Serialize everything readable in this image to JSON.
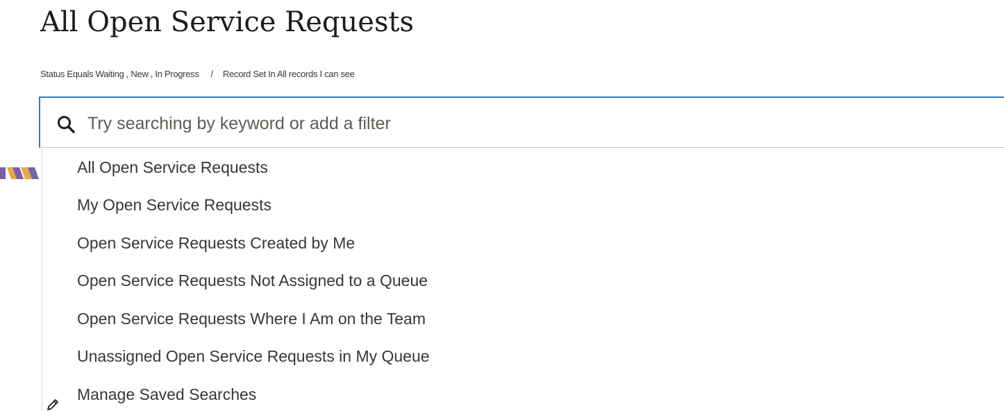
{
  "page": {
    "title": "All Open Service Requests"
  },
  "filter_summary": {
    "status": "Status Equals Waiting , New , In Progress",
    "separator": "/",
    "record_set": "Record Set In All records I can see"
  },
  "search": {
    "icon": "search-icon",
    "placeholder": "Try searching by keyword or add a filter",
    "value": "",
    "focus_color": "#2f7bbf"
  },
  "saved_searches": {
    "items": [
      {
        "label": "All Open Service Requests"
      },
      {
        "label": "My Open Service Requests"
      },
      {
        "label": "Open Service Requests Created by Me"
      },
      {
        "label": "Open Service Requests Not Assigned to a Queue"
      },
      {
        "label": "Open Service Requests Where I Am on the Team"
      },
      {
        "label": "Unassigned Open Service Requests in My Queue"
      }
    ],
    "manage": {
      "label": "Manage Saved Searches",
      "icon": "pencil-icon"
    }
  },
  "colors": {
    "stripe_purple": "#7a62a3",
    "stripe_orange": "#e8a74a"
  }
}
